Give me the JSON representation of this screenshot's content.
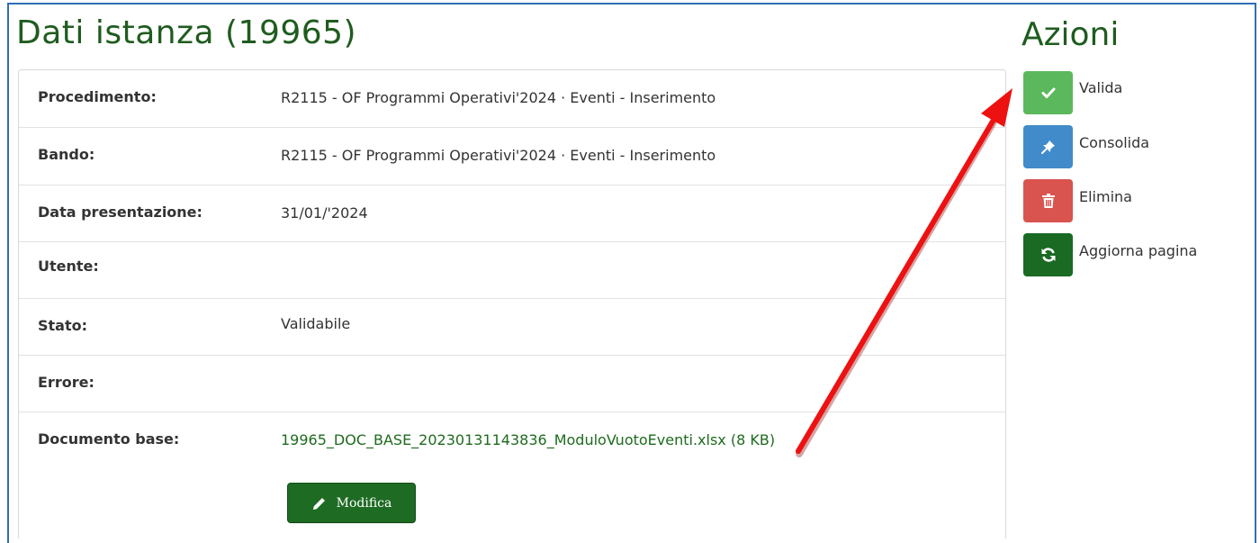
{
  "header": {
    "title": "Dati istanza (19965)"
  },
  "details": {
    "rows": [
      {
        "label": "Procedimento:",
        "value": "R2115 - OF Programmi Operativi'2024 · Eventi - Inserimento"
      },
      {
        "label": "Bando:",
        "value": "R2115 - OF Programmi Operativi'2024 · Eventi - Inserimento"
      },
      {
        "label": "Data presentazione:",
        "value": "31/01/'2024"
      },
      {
        "label": "Utente:",
        "value": ""
      },
      {
        "label": "Stato:",
        "value": "Validabile"
      },
      {
        "label": "Errore:",
        "value": ""
      },
      {
        "label": "Documento base:",
        "value": "19965_DOC_BASE_20230131143836_ModuloVuotoEventi.xlsx (8 KB)"
      }
    ],
    "edit_button_label": "Modifica"
  },
  "actions": {
    "title": "Azioni",
    "items": [
      {
        "label": "Valida",
        "icon": "check-icon",
        "color": "#5cb85c"
      },
      {
        "label": "Consolida",
        "icon": "pin-icon",
        "color": "#428bca"
      },
      {
        "label": "Elimina",
        "icon": "trash-icon",
        "color": "#d9534f"
      },
      {
        "label": "Aggiorna pagina",
        "icon": "refresh-icon",
        "color": "#1a6a24"
      }
    ]
  },
  "colors": {
    "accent_green": "#1f5c1f",
    "frame_blue": "#2f6fb3",
    "arrow_red": "#ee1111"
  }
}
